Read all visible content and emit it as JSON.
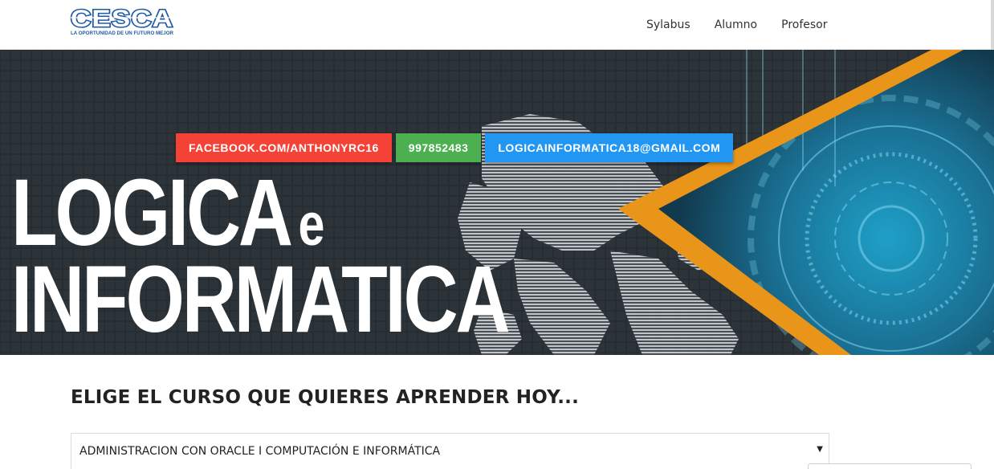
{
  "brand": {
    "logo_text": "CESCA",
    "tagline": "LA OPORTUNIDAD DE UN FUTURO MEJOR"
  },
  "nav": {
    "items": [
      "Sylabus",
      "Alumno",
      "Profesor"
    ]
  },
  "hero": {
    "title_line1": "LOGICA",
    "title_connector": "e",
    "title_line2": "INFORMATICA",
    "contacts": {
      "facebook": "FACEBOOK.COM/ANTHONYRC16",
      "phone": "997852483",
      "email": "LOGICAINFORMATICA18@GMAIL.COM"
    }
  },
  "main": {
    "heading": "ELIGE EL CURSO QUE QUIERES APRENDER HOY...",
    "course_select": {
      "selected": "ADMINISTRACION CON ORACLE I COMPUTACIÓN E INFORMÁTICA",
      "caret_icon": "caret-down-icon"
    }
  },
  "colors": {
    "facebook_button": "#f44336",
    "phone_button": "#4caf50",
    "email_button": "#2196f3",
    "hero_accent": "#e8951a",
    "logo_blue": "#1f5aa6"
  }
}
